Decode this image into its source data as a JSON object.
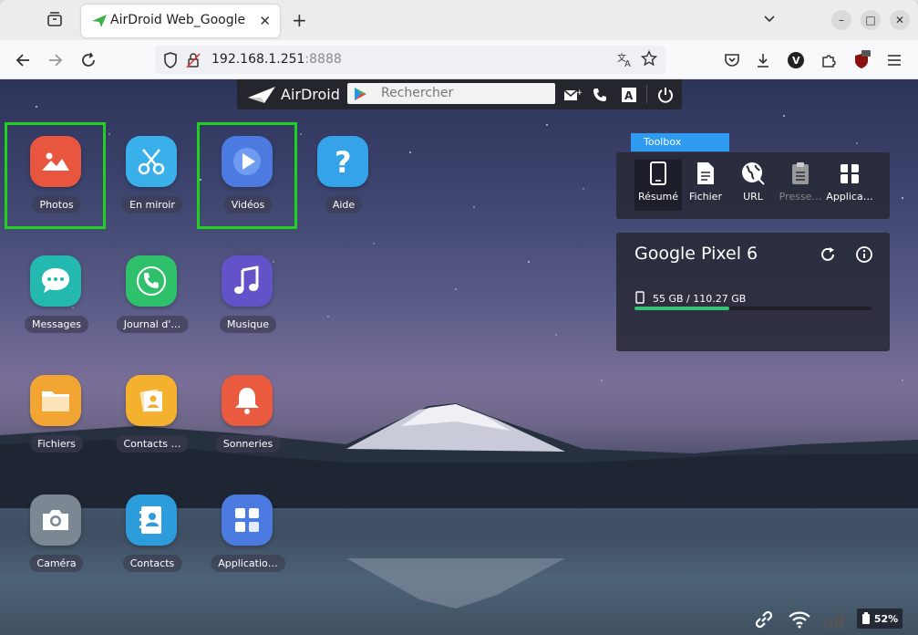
{
  "browser": {
    "tab_title": "AirDroid Web_Google Pixel 6",
    "url_host": "192.168.1.251",
    "url_port": ":8888"
  },
  "topbar": {
    "logo_text": "AirDroid",
    "search_placeholder": "Rechercher"
  },
  "apps": [
    {
      "label": "Photos",
      "icon": "photos-icon",
      "color": "#e8563f"
    },
    {
      "label": "En miroir",
      "icon": "scissors-icon",
      "color": "#3ab0ea"
    },
    {
      "label": "Vidéos",
      "icon": "play-icon",
      "color": "#4b7be0"
    },
    {
      "label": "Aide",
      "icon": "help-icon",
      "color": "#35a3ea"
    },
    {
      "label": "Messages",
      "icon": "chat-icon",
      "color": "#23b9b0"
    },
    {
      "label": "Journal d'…",
      "icon": "phone-icon",
      "color": "#2fc06b"
    },
    {
      "label": "Musique",
      "icon": "music-icon",
      "color": "#6353c9"
    },
    {
      "label": "Fichiers",
      "icon": "folder-icon",
      "color": "#f2a533"
    },
    {
      "label": "Contacts …",
      "icon": "contacts-fav-icon",
      "color": "#f4b12d"
    },
    {
      "label": "Sonneries",
      "icon": "bell-icon",
      "color": "#ea5a3e"
    },
    {
      "label": "Caméra",
      "icon": "camera-icon",
      "color": "#7c8794"
    },
    {
      "label": "Contacts",
      "icon": "contacts-icon",
      "color": "#2d9cdb"
    },
    {
      "label": "Applicatio…",
      "icon": "apps-icon",
      "color": "#4b7be0"
    }
  ],
  "toolbox": {
    "tab_label": "Toolbox",
    "items": [
      {
        "label": "Résumé",
        "icon": "phone-device-icon"
      },
      {
        "label": "Fichier",
        "icon": "file-icon"
      },
      {
        "label": "URL",
        "icon": "globe-icon"
      },
      {
        "label": "Presse…",
        "icon": "clipboard-icon"
      },
      {
        "label": "Applica…",
        "icon": "package-icon"
      }
    ]
  },
  "device": {
    "name": "Google Pixel 6",
    "storage_text": "55 GB / 110.27 GB",
    "storage_fraction": 0.4,
    "accent": "#34c473"
  },
  "status": {
    "battery": "52%"
  }
}
